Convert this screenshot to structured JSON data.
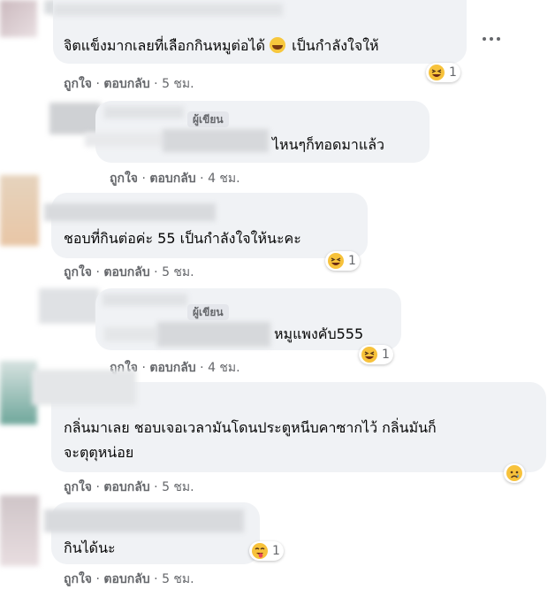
{
  "comments": [
    {
      "text": "จิตแข็งมากเลยที่เลือกกินหมูต่อได้",
      "text2": "เป็นกำลังใจให้",
      "reaction_count": "1",
      "time": "5 ชม."
    },
    {
      "text": "ไหนๆก็ทอดมาแล้ว",
      "author_badge": "ผู้เขียน",
      "time": "4 ชม."
    },
    {
      "text": "ชอบที่กินต่อค่ะ 55 เป็นกำลังใจให้นะคะ",
      "reaction_count": "1",
      "time": "5 ชม."
    },
    {
      "text": "หมูแพงคับ555",
      "author_badge": "ผู้เขียน",
      "reaction_count": "1",
      "time": "4 ชม."
    },
    {
      "text": "กลิ่นมาเลย ชอบเจอเวลามันโดนประตูหนีบคาซากไว้ กลิ่นมันก็",
      "text2": "จะตุตุหน่อย",
      "time": "5 ชม."
    },
    {
      "text": "กินได้นะ",
      "reaction_count": "1",
      "time": "5 ชม."
    }
  ],
  "actions": {
    "like": "ถูกใจ",
    "reply": "ตอบกลับ",
    "sep": "·"
  },
  "icons": {
    "more": "more-options-icon",
    "haha": "haha-reaction-icon",
    "sad": "sad-reaction-icon",
    "yummy": "yummy-reaction-icon"
  }
}
